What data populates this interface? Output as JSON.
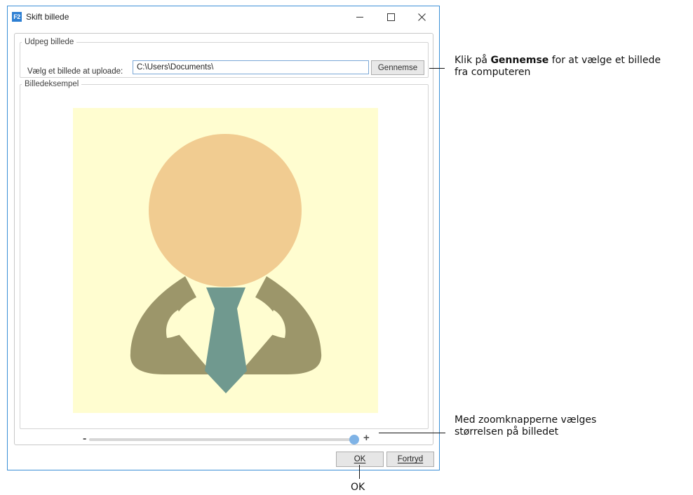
{
  "window": {
    "app_icon_text": "F2",
    "title": "Skift billede",
    "accent_color": "#3a8fd6"
  },
  "upload_group": {
    "legend": "Udpeg billede",
    "label": "Vælg et billede at uploade:",
    "path_value": "C:\\Users\\Documents\\",
    "browse_label": "Gennemse"
  },
  "preview_group": {
    "legend": "Billedeksempel",
    "image_icon": "person-avatar-icon",
    "colors": {
      "background": "#fffdd0",
      "head": "#f1cc91",
      "body": "#9c966a",
      "tie": "#70998f"
    }
  },
  "zoom": {
    "minus_label": "-",
    "plus_label": "+",
    "value_fraction": 1.0
  },
  "buttons": {
    "ok_label": "OK",
    "cancel_label": "Fortryd"
  },
  "annotations": {
    "browse_pre": "Klik på ",
    "browse_bold": "Gennemse",
    "browse_post": " for at vælge et billede",
    "browse_line2": "fra computeren",
    "zoom_line1": "Med zoomknapperne vælges",
    "zoom_line2": "størrelsen på billedet",
    "ok_label": "OK"
  }
}
